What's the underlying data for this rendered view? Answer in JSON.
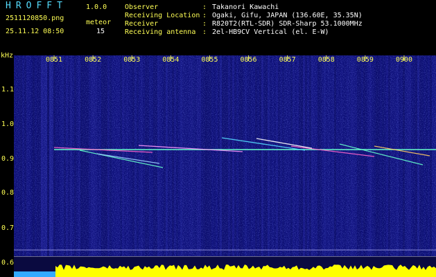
{
  "header": {
    "app_name": "HROFFT",
    "app_version": "1.0.0",
    "filename": "2511120850.png",
    "datetime": "25.11.12 08:50",
    "meteor_label": "meteor",
    "meteor_count": "15",
    "info_rows": [
      {
        "label": "Observer",
        "sep": ":",
        "value": "Takanori Kawachi"
      },
      {
        "label": "Receiving Location",
        "sep": ":",
        "value": "Ogaki, Gifu, JAPAN (136.60E, 35.35N)"
      },
      {
        "label": "Receiver",
        "sep": ":",
        "value": "R820T2(RTL-SDR) SDR-Sharp 53.1000MHz"
      },
      {
        "label": "Receiving antenna",
        "sep": ":",
        "value": "2el-HB9CV Vertical (el. E-W)"
      }
    ]
  },
  "spectrogram": {
    "unit_label": "kHz",
    "time_ticks": [
      "0851",
      "0852",
      "0853",
      "0854",
      "0855",
      "0856",
      "0857",
      "0858",
      "0859",
      "0900"
    ],
    "freq_ticks": [
      "1.1",
      "1.0",
      "0.9",
      "0.8",
      "0.7",
      "0.6"
    ],
    "background_color": "#0d0f78",
    "carrier_color": "#66ffcc",
    "level_bar_color": "#ffff00",
    "low_bar_color": "#33aaff"
  }
}
